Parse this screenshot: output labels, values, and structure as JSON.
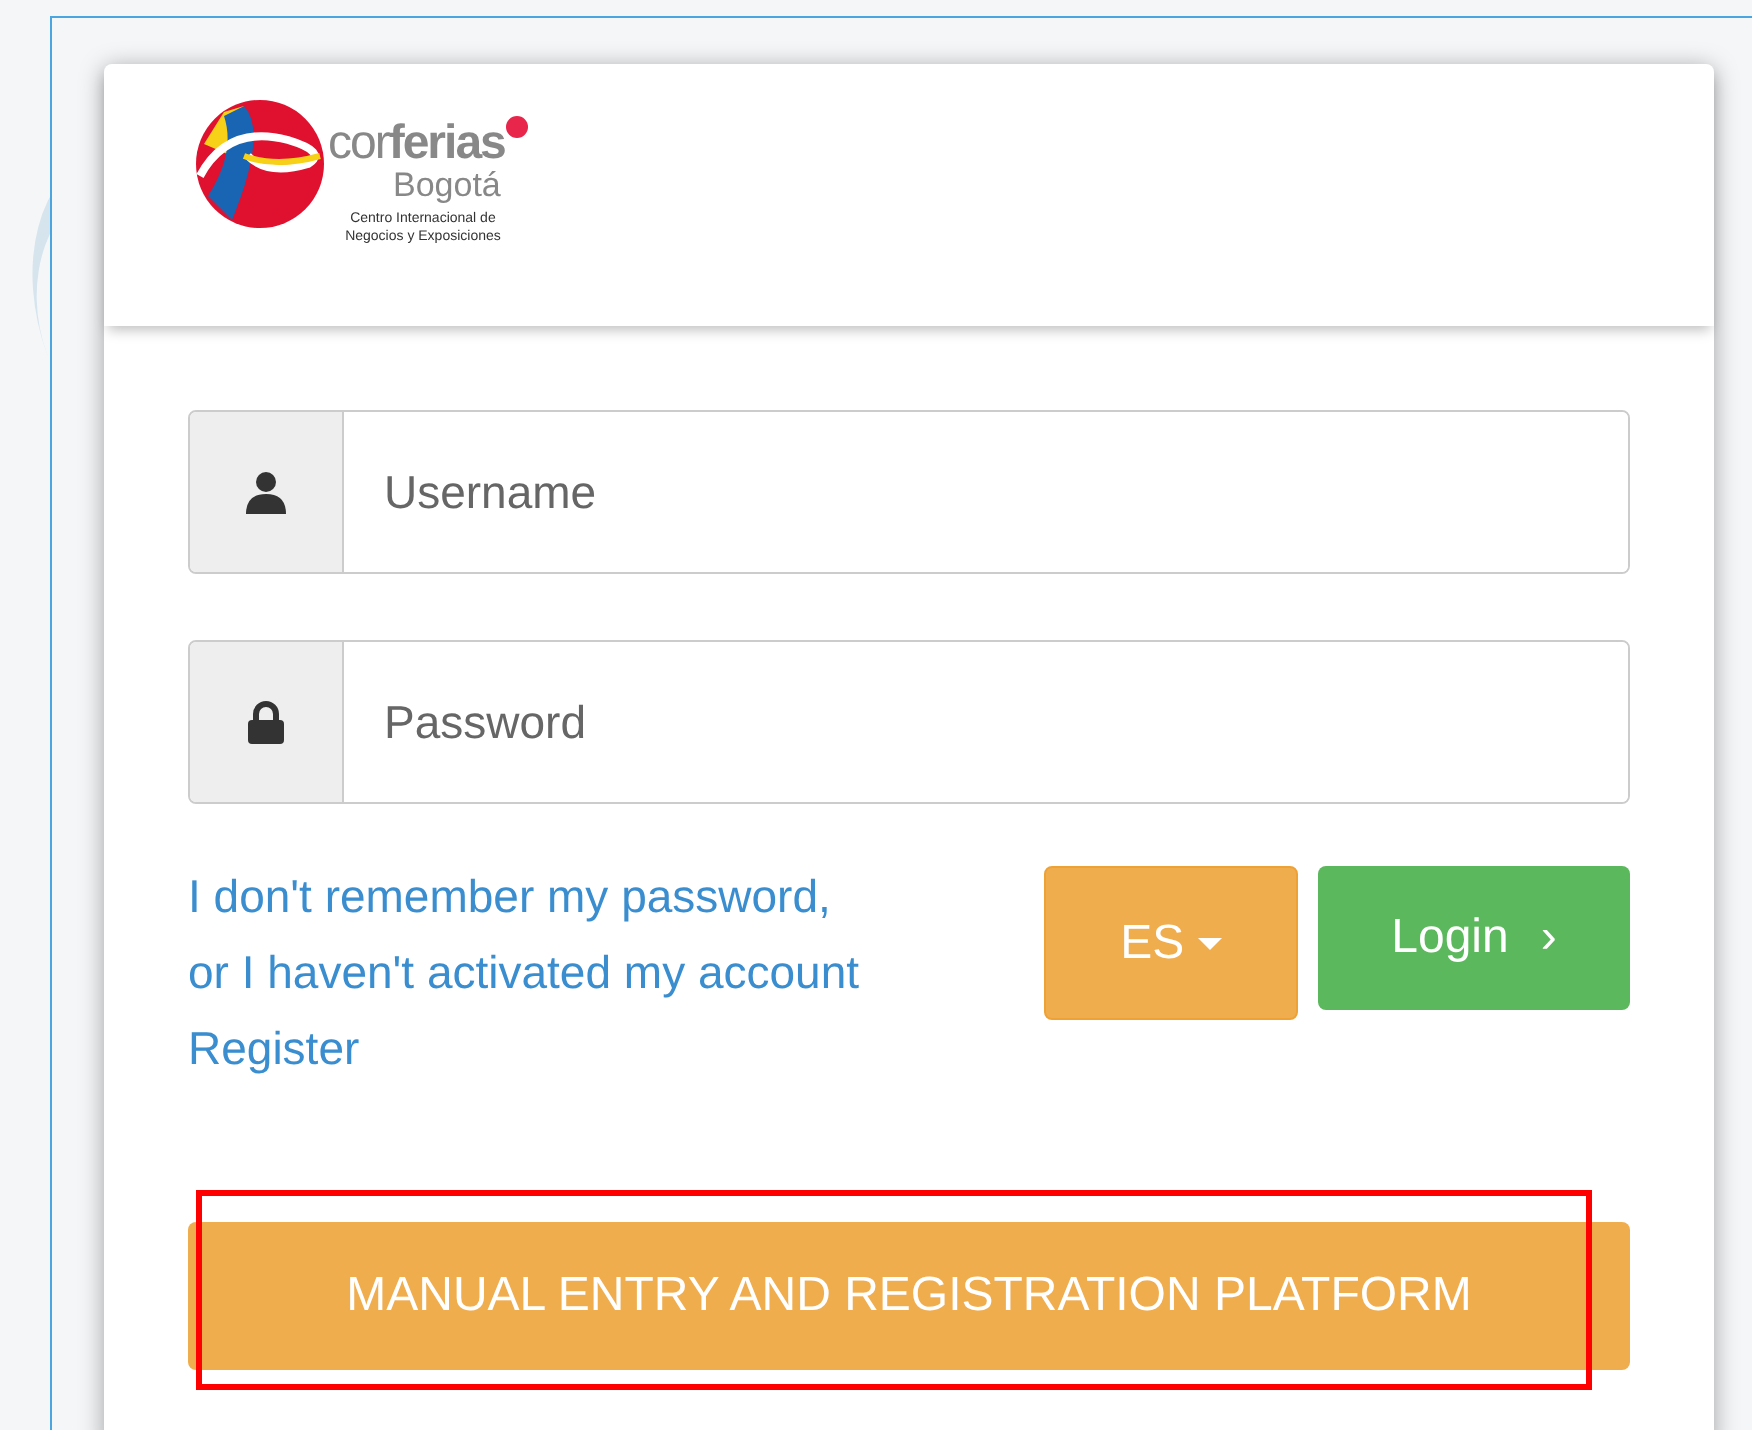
{
  "logo": {
    "wordmark": "cor**ferias**",
    "city": "Bogotá",
    "tagline": [
      "Centro Internacional de",
      "Negocios y Exposiciones"
    ]
  },
  "fields": [
    {
      "kind": "user",
      "placeholder": "Username"
    },
    {
      "kind": "lock",
      "placeholder": "Password"
    }
  ],
  "forgot_link": [
    "I don't remember my password,",
    "or I haven't activated my account"
  ],
  "register_link": "Register",
  "language_button": {
    "label": "ES"
  },
  "login_button": {
    "label": "Login",
    "icon": "›"
  },
  "manual_button": {
    "label": "MANUAL ENTRY AND REGISTRATION PLATFORM",
    "highlighted": true
  }
}
